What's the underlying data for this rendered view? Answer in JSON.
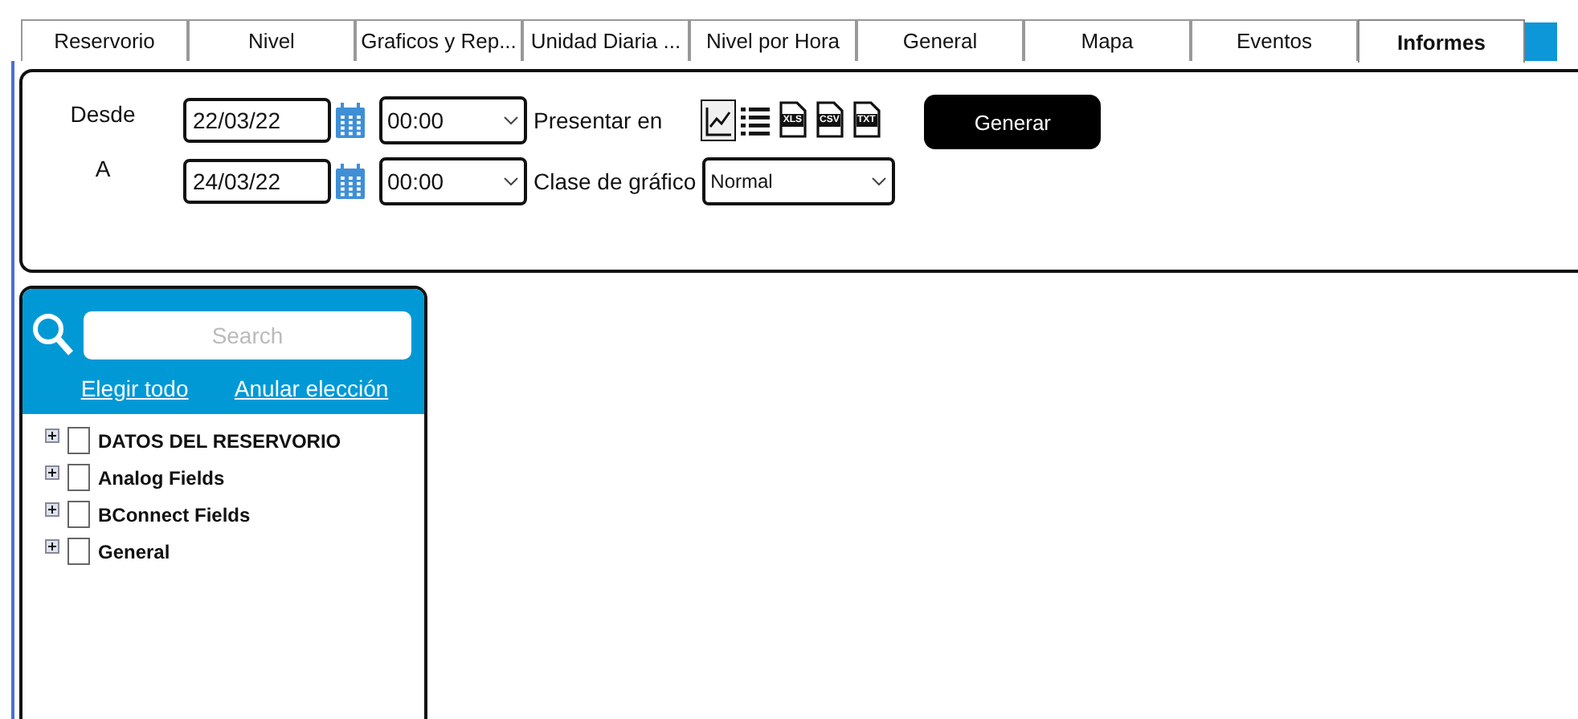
{
  "tabs": [
    {
      "label": "Reservorio",
      "selected": false
    },
    {
      "label": "Nivel",
      "selected": false
    },
    {
      "label": "Graficos y Rep...",
      "selected": false
    },
    {
      "label": "Unidad Diaria ...",
      "selected": false
    },
    {
      "label": "Nivel por Hora",
      "selected": false
    },
    {
      "label": "General",
      "selected": false
    },
    {
      "label": "Mapa",
      "selected": false
    },
    {
      "label": "Eventos",
      "selected": false
    },
    {
      "label": "Informes",
      "selected": true
    }
  ],
  "filters": {
    "from_label": "Desde",
    "from_date": "22/03/22",
    "from_time": "00:00",
    "to_label": "A",
    "to_date": "24/03/22",
    "to_time": "00:00",
    "present_label": "Presentar en",
    "formats": [
      {
        "kind": "chart",
        "selected": true
      },
      {
        "kind": "list",
        "selected": false
      },
      {
        "kind": "file",
        "tag": "XLS",
        "selected": false
      },
      {
        "kind": "file",
        "tag": "CSV",
        "selected": false
      },
      {
        "kind": "file",
        "tag": "TXT",
        "selected": false
      }
    ],
    "chart_type_label": "Clase de gráfico",
    "chart_type": "Normal",
    "generate_button": "Generar"
  },
  "field_panel": {
    "search": {
      "placeholder": "Search"
    },
    "select_all": "Elegir todo",
    "clear_selection": "Anular elección",
    "tree": [
      {
        "label": "DATOS DEL RESERVORIO",
        "expanded": false,
        "checked": false
      },
      {
        "label": "Analog Fields",
        "expanded": false,
        "checked": false
      },
      {
        "label": "BConnect Fields",
        "expanded": false,
        "checked": false
      },
      {
        "label": "General",
        "expanded": false,
        "checked": false
      }
    ]
  }
}
